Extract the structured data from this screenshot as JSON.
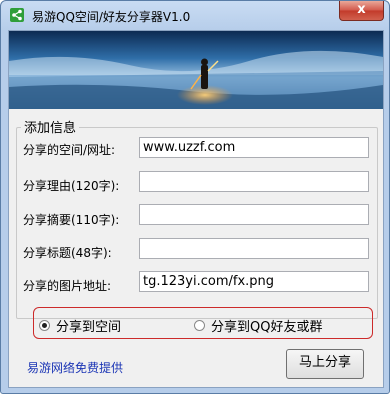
{
  "window": {
    "title": "易游QQ空间/好友分享器V1.0",
    "close_symbol": "x"
  },
  "group": {
    "title": "添加信息",
    "fields": [
      {
        "label": "分享的空间/网址:",
        "value": "www.uzzf.com"
      },
      {
        "label": "分享理由(120字):",
        "value": ""
      },
      {
        "label": "分享摘要(110字):",
        "value": ""
      },
      {
        "label": "分享标题(48字):",
        "value": ""
      },
      {
        "label": "分享的图片地址:",
        "value": "tg.123yi.com/fx.png"
      }
    ]
  },
  "options": {
    "share_to_space": "分享到空间",
    "share_to_friends": "分享到QQ好友或群",
    "selected": "share_to_space"
  },
  "footer": {
    "credit": "易游网络免费提供",
    "share_button": "马上分享"
  },
  "colors": {
    "accent_border": "#cc2a2a",
    "link": "#1b35b5",
    "app_icon": "#2f9e3a"
  }
}
